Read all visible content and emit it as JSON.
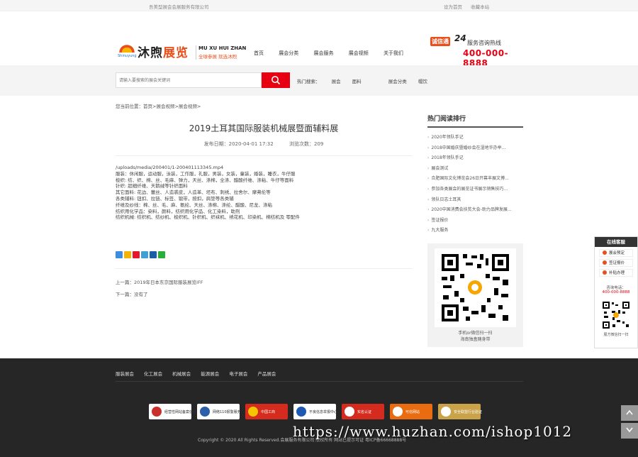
{
  "topbar": {
    "company": "吾美型展会会展服务有限公司",
    "set_home": "设为首页",
    "favorite": "收藏本站"
  },
  "logo": {
    "brand_a": "沐煦",
    "brand_b": "展览",
    "pinyin": "Shinuyung",
    "slogan_en": "MU XU HUI ZHAN",
    "slogan_cn": "全球参展 就选沐煦"
  },
  "nav": [
    "首页",
    "展会分类",
    "展会服务",
    "展会视频",
    "关于我们"
  ],
  "hotline": {
    "badge": "诚信通",
    "label": "服务咨询热线",
    "number": "400-000-8888"
  },
  "search": {
    "placeholder": "请输入要搜索的展会关键词",
    "hot_label": "热门搜索：",
    "hot": [
      "展会",
      "面料",
      "展会分类",
      "帽饮"
    ]
  },
  "breadcrumb": "您当前位置：首页>展会视频>展会视频>",
  "article": {
    "title": "2019土耳其国际服装机械展暨面辅料展",
    "date": "发布日期：2020-04-01 17:32",
    "views": "浏览次数：209",
    "lines": [
      "/uploads/media/200401/1-200401113345.mp4",
      "服装：休闲服，运动服，泳装，工作服，礼服，男装，女装，童装，婚装，睡衣，牛仔服",
      "梭织: 纺、织、棉、丝、毛麻、弹力，天丝、涤棉，全涤、醋酸纤维、涤粘、牛仔等面料",
      "针织: 超细纤维、天鹅绒等针织面料",
      "其它面料: 花边、蕾丝、人造裘皮，人造革、坯布、刺绣、拉舍尔、摩弗伦等",
      "各类辅料: 钮扣、拉链、标签、锻带，按扣，肩垫等各类辅",
      "纤维及纱线：棉、丝、毛、麻、氨纶、天丝、涤棉、涤纶、醋酸、尼龙、涤粘",
      "纺织用化学品：染料，颜料，纺织用化学品、化工染料，助剂",
      "纺织机械: 纺织机、纺纱机、梭织机、针织机、织袜机、绣花机、印染机、棉纺机及 零配件"
    ],
    "prev": "上一篇：2019年日本东京国际服装展览IFF",
    "next": "下一篇：没有了"
  },
  "sidebar": {
    "heading": "热门阅读排行",
    "items": [
      "2020年领队手记",
      "2018中国婚庆暨婚纱会在湿地华办举...",
      "2018年领队手记",
      "展会测试",
      "合肥国际文化博览会26日开幕丰展文博...",
      "参加各类展会的展览证书展示销售技巧...",
      "领队日志土耳其",
      "2020中国消费会扶贫大会-助力品牌发展...",
      "签证报价",
      "九大服务"
    ],
    "qr_cap1": "手机or微信扫一扫",
    "qr_cap2": "海南独盒随身带"
  },
  "float": {
    "head": "在线客服",
    "items": [
      "展会预定",
      "签证报价",
      "补贴办理"
    ],
    "tel_label": "咨询电话：",
    "tel": "400-000-8888",
    "qr_cap": "展方微信扫一扫"
  },
  "footer": {
    "links": [
      "服装展会",
      "化工展会",
      "机械展会",
      "能源展会",
      "电子展会",
      "产品展会"
    ],
    "badges": [
      "经营性网站备案信息",
      "网络110报警服务",
      "中国工商",
      "不良信息举报中心",
      "实名认证",
      "可信网站",
      "安全联盟行业验证"
    ],
    "copyright": "Copyright © 2020 All Rights Reserved.会展服务有限公司 版权所有   网站已提示可证   粤ICP备66668888号"
  },
  "watermark": "https://www.huzhan.com/ishop1012",
  "colors": {
    "accent": "#e60012",
    "orange": "#e94e1b",
    "footer_bg": "#262626"
  }
}
